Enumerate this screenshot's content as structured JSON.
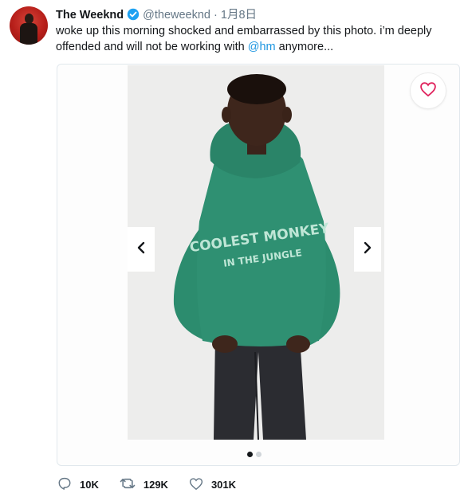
{
  "tweet": {
    "author_name": "The Weeknd",
    "handle": "@theweeknd",
    "separator": "·",
    "date": "1月8日",
    "text_before": "woke up this morning shocked and embarrassed by this photo. i’m deeply offended and will not be working with ",
    "mention": "@hm",
    "text_after": " anymore..."
  },
  "media": {
    "hoodie_text_line1": "COOLEST MONKEY",
    "hoodie_text_line2": "IN THE JUNGLE",
    "carousel_dots": 2,
    "active_dot": 0
  },
  "actions": {
    "replies": "10K",
    "retweets": "129K",
    "likes": "301K"
  },
  "colors": {
    "link": "#1b95e0",
    "verified": "#1da1f2",
    "heart": "#e0245e",
    "hoodie": "#2c8c6e"
  }
}
